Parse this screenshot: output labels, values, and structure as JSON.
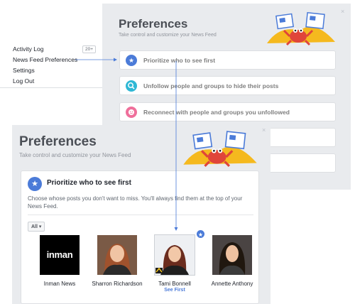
{
  "menu": {
    "items": [
      {
        "label": "Activity Log"
      },
      {
        "label": "News Feed Preferences"
      },
      {
        "label": "Settings"
      },
      {
        "label": "Log Out"
      }
    ],
    "activity_badge": "20+"
  },
  "back_panel": {
    "title": "Preferences",
    "subtitle": "Take control and customize your News Feed",
    "close": "×",
    "rows": [
      {
        "label": "Prioritize who to see first",
        "icon": "star-icon",
        "color": "#4b7bd8"
      },
      {
        "label": "Unfollow people and groups to hide their posts",
        "icon": "search-icon",
        "color": "#2fb8d5"
      },
      {
        "label": "Reconnect with people and groups you unfollowed",
        "icon": "face-icon",
        "color": "#ef6f9b"
      },
      {
        "label": ""
      },
      {
        "label": ""
      }
    ]
  },
  "front_panel": {
    "title": "Preferences",
    "subtitle": "Take control and customize your News Feed",
    "close": "×",
    "card": {
      "title": "Prioritize who to see first",
      "description": "Choose whose posts you don't want to miss. You'll always find them at the top of your News Feed.",
      "filter": "All ▾",
      "people": [
        {
          "name": "Inman News",
          "logo_text": "inman",
          "see_first": ""
        },
        {
          "name": "Sharron Richardson",
          "see_first": ""
        },
        {
          "name": "Tami Bonnell",
          "see_first": "See First"
        },
        {
          "name": "Annette Anthony",
          "see_first": ""
        }
      ]
    }
  },
  "colors": {
    "accent": "#4b7bd8",
    "panel_bg": "#e9ebee"
  }
}
